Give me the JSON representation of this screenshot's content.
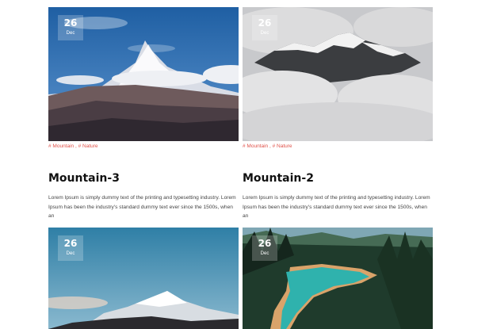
{
  "posts": [
    {
      "day": "26",
      "month": "Dec",
      "tags": [
        "# Mountain",
        "# Nature"
      ],
      "tag_separator": ",",
      "title": "Mountain-3",
      "excerpt": "Lorem Ipsum is simply dummy text of the printing and typesetting industry. Lorem Ipsum has been the industry's standard dummy text ever since the 1500s, when an"
    },
    {
      "day": "26",
      "month": "Dec",
      "tags": [
        "# Mountain",
        "# Nature"
      ],
      "tag_separator": ",",
      "title": "Mountain-2",
      "excerpt": "Lorem Ipsum is simply dummy text of the printing and typesetting industry. Lorem Ipsum has been the industry's standard dummy text ever since the 1500s, when an"
    },
    {
      "day": "26",
      "month": "Dec"
    },
    {
      "day": "26",
      "month": "Dec"
    }
  ],
  "colors": {
    "tag": "#e0524a",
    "title": "#111111",
    "text": "#444444"
  }
}
